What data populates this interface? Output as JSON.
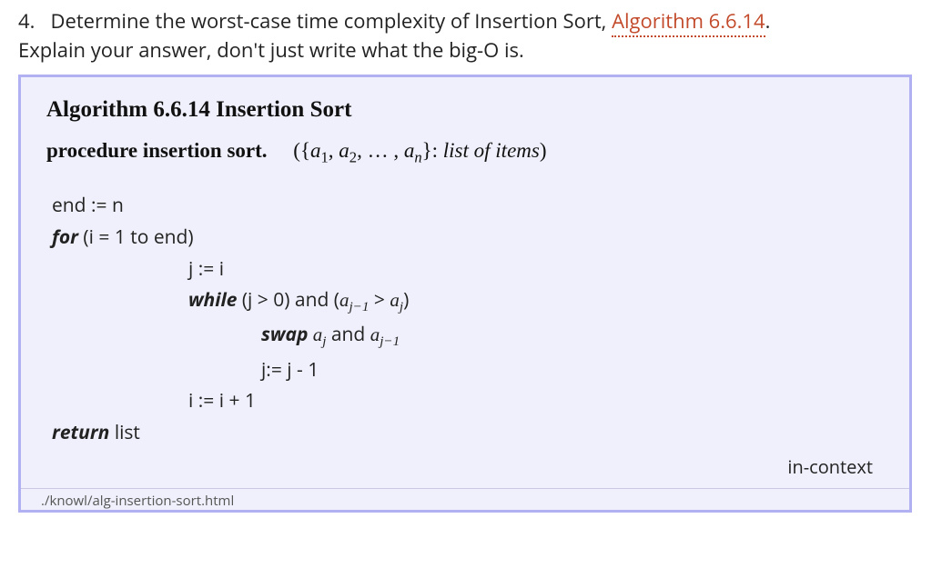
{
  "question": {
    "number": "4.",
    "text_before_link": "Determine the worst-case time complexity of Insertion Sort, ",
    "link_text": "Algorithm 6.6.14",
    "period": ".",
    "text_line2": "Explain your answer, don't just write what the big-O is."
  },
  "algorithm": {
    "heading": "Algorithm 6.6.14  Insertion Sort",
    "procedure_label": "procedure insertion sort.",
    "procedure_args_prefix": "({",
    "procedure_args_a1": "a",
    "procedure_args_sub1": "1",
    "procedure_args_sep": ", ",
    "procedure_args_a2": "a",
    "procedure_args_sub2": "2",
    "procedure_args_dots": ", … , ",
    "procedure_args_an": "a",
    "procedure_args_subn": "n",
    "procedure_args_suffix": "}: ",
    "procedure_args_desc": "list of items",
    "procedure_close": ")",
    "lines": {
      "l1": "end := n",
      "l2_kw": "for",
      "l2_rest": " (i = 1 to end)",
      "l3": "j := i",
      "l4_kw": "while",
      "l4_text_a": " (j > 0) and (",
      "l4_aj1": "a",
      "l4_sub_j1": "j−1",
      "l4_gt": " > ",
      "l4_aj": "a",
      "l4_sub_j": "j",
      "l4_close": ")",
      "l5_kw": "swap",
      "l5_a1": " a",
      "l5_sub1": "j",
      "l5_and": " and ",
      "l5_a2": "a",
      "l5_sub2": "j−1",
      "l6": "j:= j - 1",
      "l7": "i := i + 1",
      "l8_kw": "return",
      "l8_rest": " list"
    },
    "in_context": "in-context",
    "source_path": "./knowl/alg-insertion-sort.html"
  }
}
